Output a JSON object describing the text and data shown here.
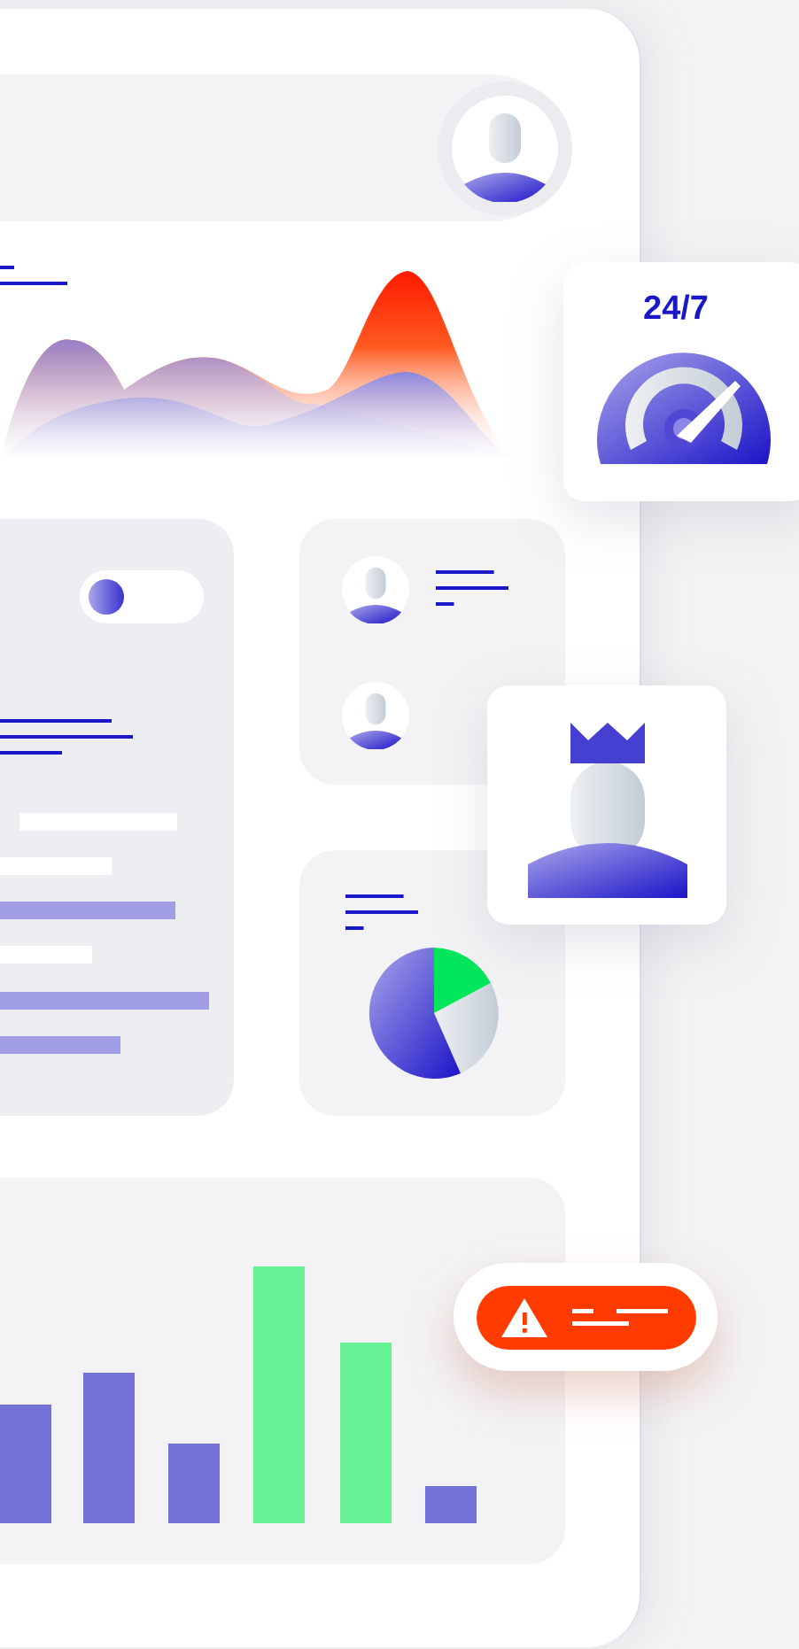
{
  "uptime_card": {
    "text": "24/7"
  },
  "settings_card": {
    "toggle": {
      "on": false
    }
  }
}
